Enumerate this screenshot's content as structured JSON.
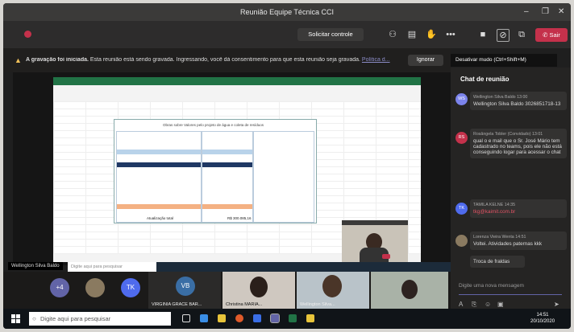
{
  "window": {
    "title": "Reunião Equipe Técnica CCI",
    "minimize": "–",
    "restore": "❐",
    "close": "✕"
  },
  "toolbar": {
    "request_control": "Solicitar controle",
    "leave_label": "Sair",
    "more_icon": "more-horizontal-icon",
    "colors": {
      "leave": "#c4314b",
      "recording_dot": "#c4314b"
    }
  },
  "banner": {
    "bold": "A gravação foi iniciada.",
    "text": "Esta reunião está sendo gravada. Ingressando, você dá consentimento para que esta reunião seja gravada.",
    "link": "Política d...",
    "ignore": "Ignorar"
  },
  "tooltip": "Desativar mudo (Ctrl+Shift+M)",
  "shared_screen": {
    "presenter_label": "Wellington Silva Baldo",
    "chat_input_placeholder": "Digite aqui para pesquisar",
    "form_title": "Obras sobre Valores pelo projeto de água e coleta de resíduos",
    "total_label": "Atualização total",
    "total_value": "R$ 300.085,16"
  },
  "participants": [
    {
      "initials": "+4",
      "color": "#6264a7"
    },
    {
      "initials": "",
      "color": "#8a7a60"
    },
    {
      "initials": "TK",
      "color": "#4f6bed"
    },
    {
      "initials": "VB",
      "color": "#3a6ea5",
      "name": "VIRGINIA GRACE BAR..."
    },
    {
      "name": "Christina MARIA..."
    },
    {
      "name": "Wellington Silva..."
    }
  ],
  "chat": {
    "title": "Chat de reunião",
    "messages": [
      {
        "initials": "WS",
        "color": "#7b83eb",
        "author": "Wellington Silva Baldo",
        "time": "13:00",
        "text": "Wellington Silva Baldo 3026851718-13"
      },
      {
        "initials": "RS",
        "color": "#c4314b",
        "author": "Rosângela Tobler (Convidado)",
        "time": "13:01",
        "text": "qual o e mail que o Sr. José Mário tem cadastrado no teams, pois ele não está conseguindo logar para acessar o chat"
      },
      {
        "initials": "TK",
        "color": "#4f6bed",
        "author": "TAMILA KELNE",
        "time": "14:35",
        "text": "tkg@kaimit.com.br"
      },
      {
        "initials": "",
        "color": "#8a7a60",
        "author": "Lorenza Vieira Wenta",
        "time": "14:51",
        "text": "Voltei. Atividades paternas kkk"
      },
      {
        "initials": "",
        "color": "#333231",
        "author": "",
        "time": "",
        "text": "Troca de fraldas"
      }
    ],
    "compose_placeholder": "Digite uma nova mensagem"
  },
  "taskbar": {
    "search_placeholder": "Digite aqui para pesquisar",
    "time": "14:51",
    "date": "20/10/2020"
  }
}
